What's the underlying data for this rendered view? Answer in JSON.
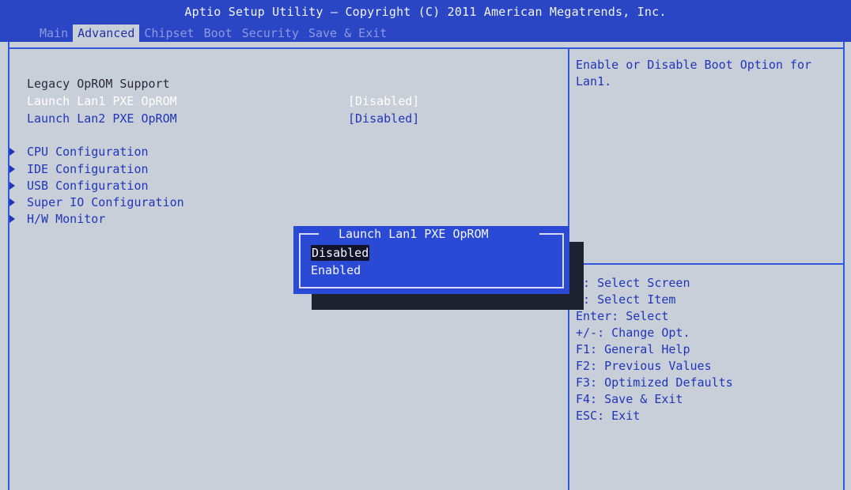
{
  "header": {
    "title": "Aptio Setup Utility – Copyright (C) 2011 American Megatrends, Inc.",
    "tabs": [
      {
        "label": "Main",
        "active": false
      },
      {
        "label": "Advanced",
        "active": true
      },
      {
        "label": "Chipset",
        "active": false
      },
      {
        "label": "Boot",
        "active": false
      },
      {
        "label": "Security",
        "active": false
      },
      {
        "label": "Save & Exit",
        "active": false
      }
    ]
  },
  "settings": {
    "section_label": "Legacy OpROM Support",
    "lan1": {
      "label": "Launch Lan1 PXE OpROM",
      "value": "[Disabled]"
    },
    "lan2": {
      "label": "Launch Lan2 PXE OpROM",
      "value": "[Disabled]"
    },
    "submenus": [
      "CPU Configuration",
      "IDE Configuration",
      "USB Configuration",
      "Super IO Configuration",
      "H/W Monitor"
    ]
  },
  "help": {
    "text": "Enable or Disable Boot Option for Lan1."
  },
  "keys": [
    "←: Select Screen",
    "↓: Select Item",
    "Enter: Select",
    "+/-: Change Opt.",
    "F1: General Help",
    "F2: Previous Values",
    "F3: Optimized Defaults",
    "F4: Save & Exit",
    "ESC: Exit"
  ],
  "popup": {
    "title": "Launch Lan1 PXE OpROM",
    "options": [
      "Disabled",
      "Enabled"
    ],
    "selected": "Disabled"
  },
  "colors": {
    "header_blue": "#2b46c4",
    "background_gray": "#c9cfd9",
    "item_blue": "#2036b8",
    "highlight_white": "#ffffff"
  }
}
